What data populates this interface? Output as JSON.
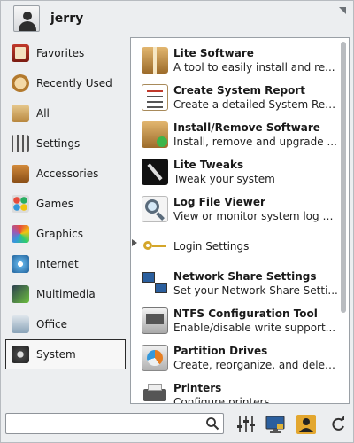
{
  "header": {
    "username": "jerry"
  },
  "categories": [
    {
      "label": "Favorites",
      "icon": "favorites-icon"
    },
    {
      "label": "Recently Used",
      "icon": "recently-used-icon"
    },
    {
      "label": "All",
      "icon": "all-icon"
    },
    {
      "label": "Settings",
      "icon": "settings-icon"
    },
    {
      "label": "Accessories",
      "icon": "accessories-icon"
    },
    {
      "label": "Games",
      "icon": "games-icon"
    },
    {
      "label": "Graphics",
      "icon": "graphics-icon"
    },
    {
      "label": "Internet",
      "icon": "internet-icon"
    },
    {
      "label": "Multimedia",
      "icon": "multimedia-icon"
    },
    {
      "label": "Office",
      "icon": "office-icon"
    },
    {
      "label": "System",
      "icon": "system-icon",
      "selected": true
    }
  ],
  "apps": [
    {
      "name": "Lite Software",
      "desc": "A tool to easily install and re...",
      "icon": "package-box-icon"
    },
    {
      "name": "Create System Report",
      "desc": "Create a detailed System Rep...",
      "icon": "clipboard-report-icon"
    },
    {
      "name": "Install/Remove Software",
      "desc": "Install, remove and upgrade ...",
      "icon": "package-install-icon"
    },
    {
      "name": "Lite Tweaks",
      "desc": "Tweak your system",
      "icon": "tweaks-brush-icon"
    },
    {
      "name": "Log File Viewer",
      "desc": "View or monitor system log fil...",
      "icon": "magnifier-log-icon"
    },
    {
      "name": "Login Settings",
      "desc": "",
      "icon": "keys-icon"
    },
    {
      "name": "Network Share Settings",
      "desc": "Set your Network Share Setti...",
      "icon": "network-computers-icon"
    },
    {
      "name": "NTFS Configuration Tool",
      "desc": "Enable/disable write support...",
      "icon": "drive-icon"
    },
    {
      "name": "Partition Drives",
      "desc": "Create, reorganize, and delet...",
      "icon": "partition-disk-icon"
    },
    {
      "name": "Printers",
      "desc": "Configure printers",
      "icon": "printer-icon"
    }
  ],
  "search": {
    "value": "",
    "placeholder": ""
  },
  "toolbar": {
    "mixer": "mixer-icon",
    "monitor": "monitor-lock-icon",
    "user": "user-switch-icon",
    "refresh": "refresh-icon"
  },
  "colors": {
    "selected_border": "#2b2b2b",
    "panel_bg": "#eceef0",
    "list_bg": "#ffffff"
  }
}
